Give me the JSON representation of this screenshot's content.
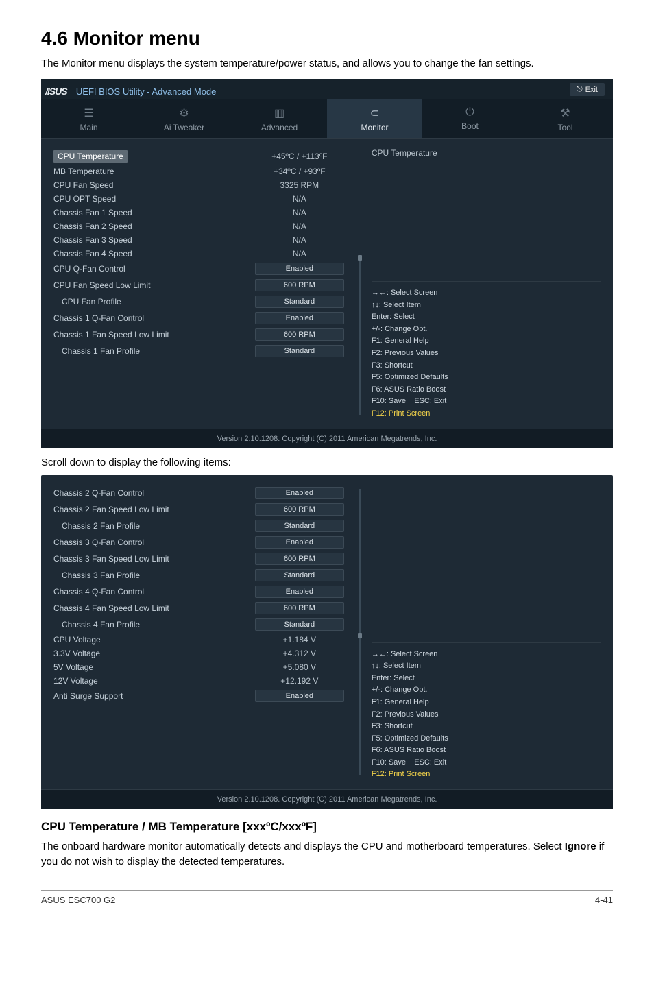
{
  "page": {
    "title": "4.6    Monitor menu",
    "intro": "The Monitor menu displays the system temperature/power status, and allows you to change the fan settings.",
    "mid_text": "Scroll down to display the following items:",
    "subhead": "CPU Temperature / MB Temperature [xxxºC/xxxºF]",
    "body1": "The onboard hardware monitor automatically detects and displays the CPU and motherboard temperatures. Select ",
    "body_bold": "Ignore",
    "body2": " if you do not wish to display the detected temperatures.",
    "footer_left": "ASUS ESC700 G2",
    "footer_right": "4-41"
  },
  "bios": {
    "title": "UEFI BIOS Utility - Advanced Mode",
    "exit": "Exit",
    "tabs": [
      {
        "label": "Main",
        "icon": "☰"
      },
      {
        "label": "Ai Tweaker",
        "icon": "⚙"
      },
      {
        "label": "Advanced",
        "icon": "▥"
      },
      {
        "label": "Monitor",
        "icon": "⊂"
      },
      {
        "label": "Boot",
        "icon": "⏻"
      },
      {
        "label": "Tool",
        "icon": "⚒"
      }
    ],
    "right_title": "CPU Temperature",
    "help": {
      "l1": "→←: Select Screen",
      "l2": "↑↓: Select Item",
      "l3": "Enter: Select",
      "l4": "+/-: Change Opt.",
      "l5": "F1: General Help",
      "l6": "F2: Previous Values",
      "l7": "F3: Shortcut",
      "l8": "F5: Optimized Defaults",
      "l9": "F6: ASUS Ratio Boost",
      "l10a": "F10: Save",
      "l10b": "ESC: Exit",
      "l11": "F12: Print Screen"
    },
    "rows1": [
      {
        "label": "CPU Temperature",
        "value": "+45ºC / +113ºF",
        "type": "plain",
        "selected": true
      },
      {
        "label": "MB Temperature",
        "value": "+34ºC / +93ºF",
        "type": "plain"
      },
      {
        "label": "CPU Fan Speed",
        "value": "3325 RPM",
        "type": "plain"
      },
      {
        "label": "CPU OPT Speed",
        "value": "N/A",
        "type": "plain"
      },
      {
        "label": "Chassis Fan 1 Speed",
        "value": "N/A",
        "type": "plain"
      },
      {
        "label": "Chassis Fan 2 Speed",
        "value": "N/A",
        "type": "plain"
      },
      {
        "label": "Chassis Fan 3 Speed",
        "value": "N/A",
        "type": "plain"
      },
      {
        "label": "Chassis Fan 4 Speed",
        "value": "N/A",
        "type": "plain"
      },
      {
        "label": "CPU Q-Fan Control",
        "value": "Enabled",
        "type": "btn"
      },
      {
        "label": "CPU Fan Speed Low Limit",
        "value": "600 RPM",
        "type": "btn"
      },
      {
        "label": "CPU Fan Profile",
        "value": "Standard",
        "type": "btn",
        "indent": true
      },
      {
        "label": "Chassis 1 Q-Fan Control",
        "value": "Enabled",
        "type": "btn"
      },
      {
        "label": "Chassis 1 Fan Speed Low Limit",
        "value": "600 RPM",
        "type": "btn"
      },
      {
        "label": "Chassis 1 Fan Profile",
        "value": "Standard",
        "type": "btn",
        "indent": true
      }
    ],
    "rows2": [
      {
        "label": "Chassis 2 Q-Fan Control",
        "value": "Enabled",
        "type": "btn"
      },
      {
        "label": "Chassis 2 Fan Speed Low Limit",
        "value": "600 RPM",
        "type": "btn"
      },
      {
        "label": "Chassis 2 Fan Profile",
        "value": "Standard",
        "type": "btn",
        "indent": true
      },
      {
        "label": "Chassis 3 Q-Fan Control",
        "value": "Enabled",
        "type": "btn"
      },
      {
        "label": "Chassis 3 Fan Speed Low Limit",
        "value": "600 RPM",
        "type": "btn"
      },
      {
        "label": "Chassis 3 Fan Profile",
        "value": "Standard",
        "type": "btn",
        "indent": true
      },
      {
        "label": "Chassis 4 Q-Fan Control",
        "value": "Enabled",
        "type": "btn"
      },
      {
        "label": "Chassis 4 Fan Speed Low Limit",
        "value": "600 RPM",
        "type": "btn"
      },
      {
        "label": "Chassis 4 Fan Profile",
        "value": "Standard",
        "type": "btn",
        "indent": true
      },
      {
        "label": "CPU Voltage",
        "value": "+1.184 V",
        "type": "plain"
      },
      {
        "label": "3.3V Voltage",
        "value": "+4.312 V",
        "type": "plain"
      },
      {
        "label": "5V Voltage",
        "value": "+5.080 V",
        "type": "plain"
      },
      {
        "label": "12V Voltage",
        "value": "+12.192 V",
        "type": "plain"
      },
      {
        "label": "Anti Surge Support",
        "value": "Enabled",
        "type": "btn"
      }
    ],
    "footer": "Version 2.10.1208.  Copyright (C) 2011 American Megatrends, Inc."
  }
}
